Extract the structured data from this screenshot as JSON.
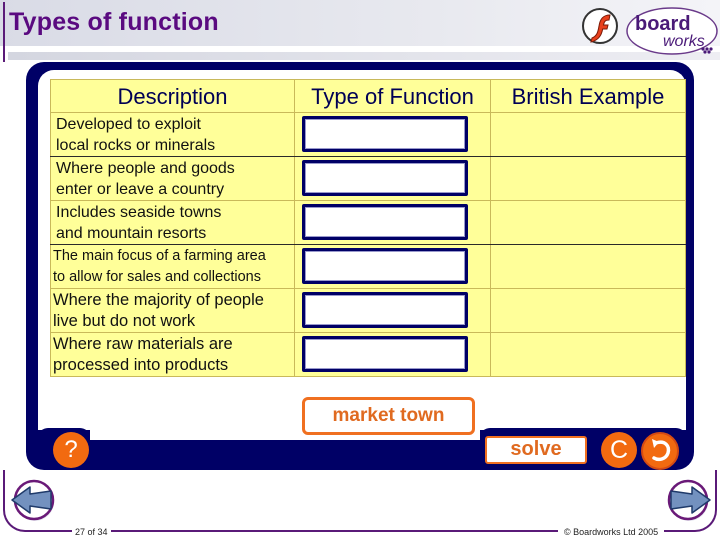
{
  "header": {
    "title": "Types of function",
    "logos": [
      "flash-logo",
      "boardworks-logo"
    ],
    "boardworks_text_top": "board",
    "boardworks_text_bottom": "works"
  },
  "table": {
    "headers": [
      "Description",
      "Type of Function",
      "British Example"
    ],
    "rows": [
      {
        "description_line1": "Developed to exploit",
        "description_line2": "local rocks or minerals",
        "type_value": "",
        "example": ""
      },
      {
        "description_line1": "Where people and goods",
        "description_line2": "enter or leave a country",
        "type_value": "",
        "example": ""
      },
      {
        "description_line1": "Includes seaside towns",
        "description_line2": "and mountain resorts",
        "type_value": "",
        "example": ""
      },
      {
        "description_line1": "The main focus of a farming area",
        "description_line2": "to allow for sales and collections",
        "type_value": "",
        "example": ""
      },
      {
        "description_line1": "Where the majority of people",
        "description_line2": "live but do not work",
        "type_value": "",
        "example": ""
      },
      {
        "description_line1": "Where raw materials are",
        "description_line2": "processed into products",
        "type_value": "",
        "example": ""
      }
    ]
  },
  "answer_card": {
    "label": "market town"
  },
  "controls": {
    "help_label": "?",
    "solve_label": "solve",
    "reset_label": "C",
    "undo_icon": "undo-arrow-icon"
  },
  "footer": {
    "page_indicator": "27 of 34",
    "copyright": "© Boardworks Ltd 2005",
    "prev_icon": "arrow-left-icon",
    "next_icon": "arrow-right-icon"
  },
  "colors": {
    "title": "#5a0a80",
    "panel": "#000066",
    "table_bg": "#ffff99",
    "accent_orange": "#f26a10",
    "nav_blue": "#6e8cb8",
    "frame_purple": "#5a1a78"
  }
}
